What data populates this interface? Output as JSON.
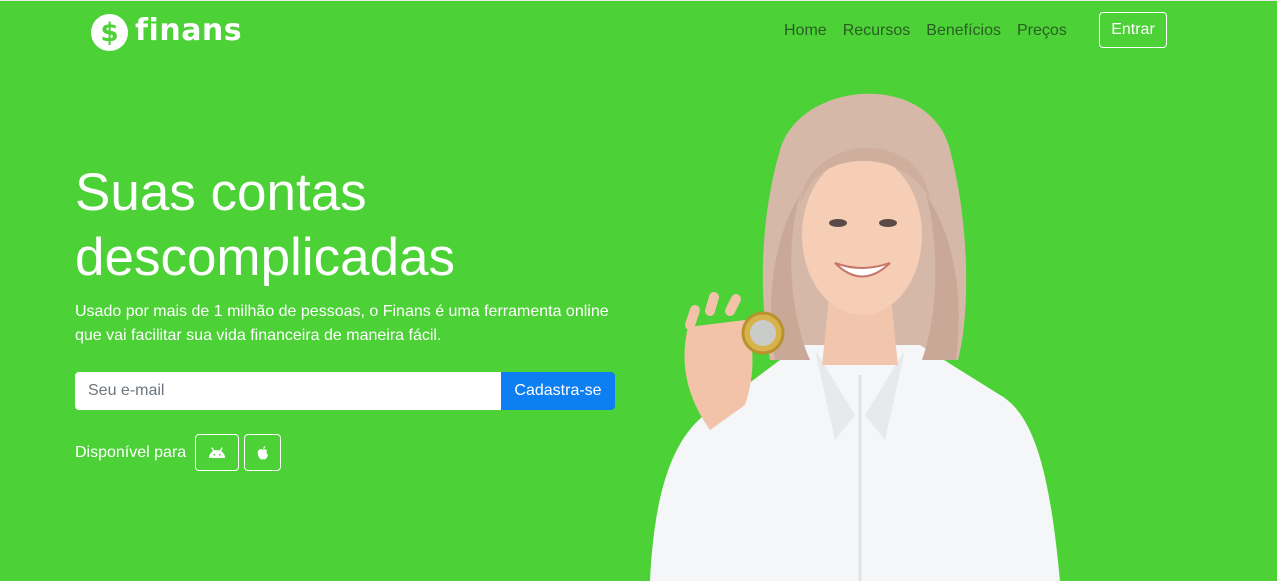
{
  "brand": {
    "name": "finans",
    "symbol": "$"
  },
  "nav": {
    "items": [
      {
        "label": "Home"
      },
      {
        "label": "Recursos"
      },
      {
        "label": "Benefícios"
      },
      {
        "label": "Preços"
      }
    ],
    "login_label": "Entrar"
  },
  "hero": {
    "title_line1": "Suas contas",
    "title_line2": "descomplicadas",
    "subtitle": "Usado por mais de 1 milhão de pessoas, o Finans é uma ferramenta online que vai facilitar sua vida financeira de maneira fácil.",
    "email_placeholder": "Seu e-mail",
    "signup_label": "Cadastra-se",
    "available_label": "Disponível para"
  },
  "icons": {
    "brand": "dollar-coin-icon",
    "android": "android-icon",
    "apple": "apple-icon"
  },
  "colors": {
    "background": "#4cd137",
    "nav_link": "#2a5e22",
    "primary_button": "#0d7ff2",
    "text": "#ffffff"
  }
}
